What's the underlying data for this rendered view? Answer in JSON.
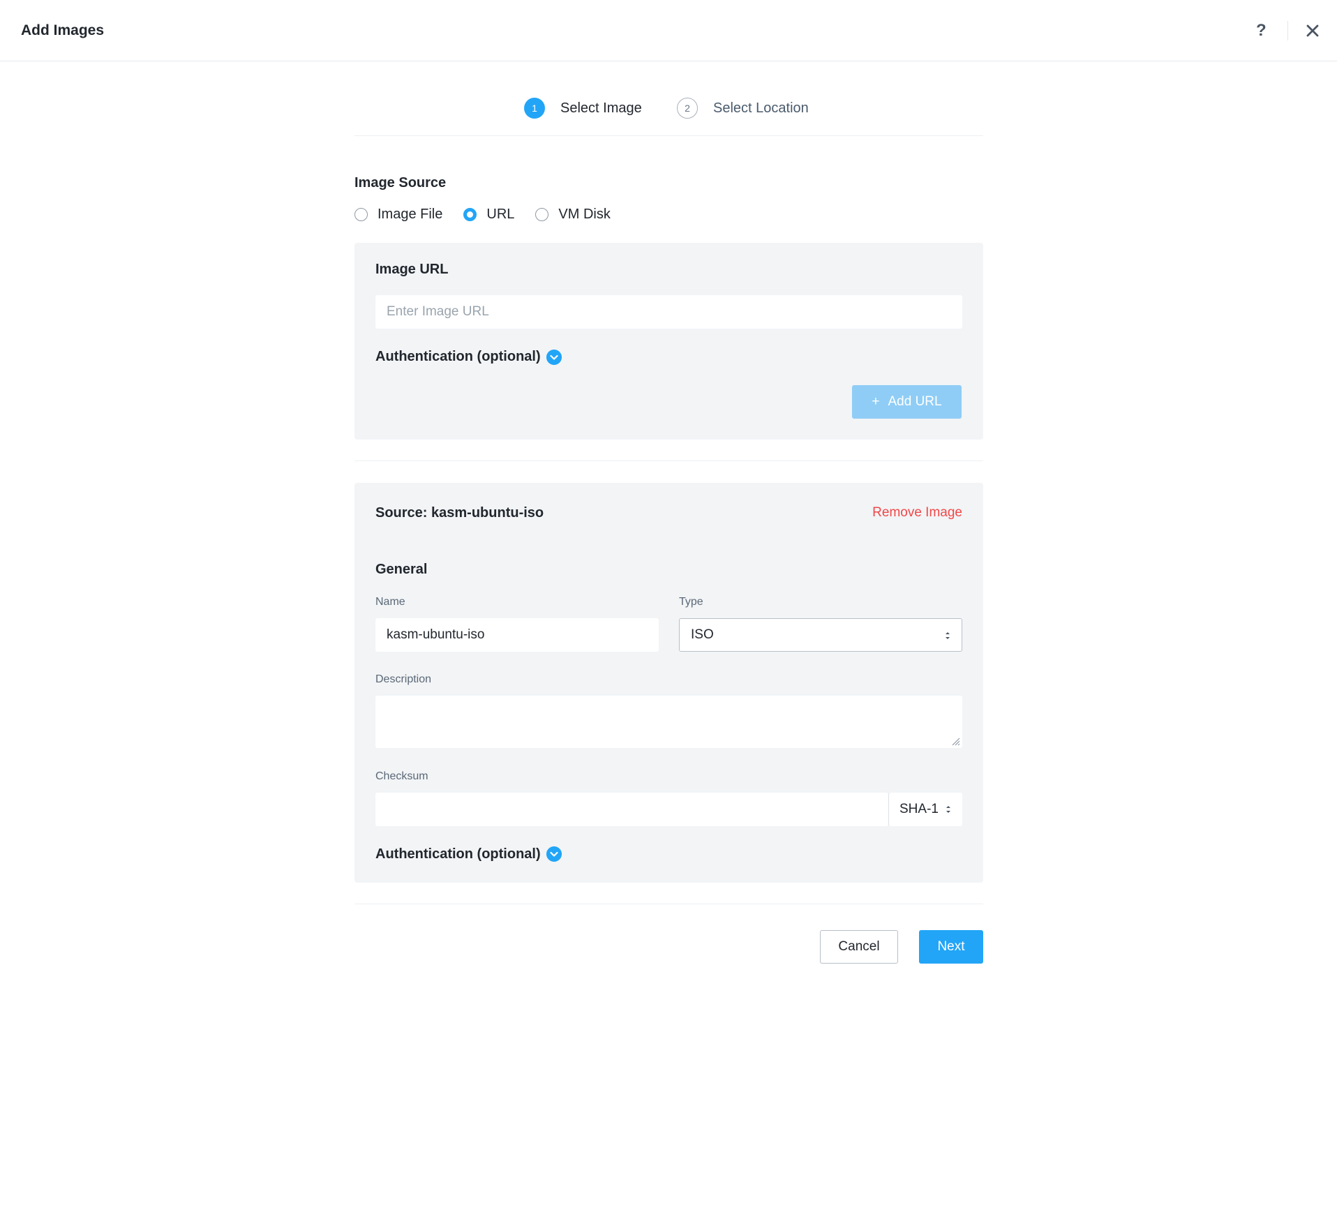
{
  "header": {
    "title": "Add Images",
    "help_icon": "?",
    "close_icon": "close-icon"
  },
  "steps": [
    {
      "num": "1",
      "label": "Select Image"
    },
    {
      "num": "2",
      "label": "Select Location"
    }
  ],
  "image_source": {
    "label": "Image Source",
    "options": [
      "Image File",
      "URL",
      "VM Disk"
    ],
    "selected": "URL"
  },
  "url_panel": {
    "label": "Image URL",
    "placeholder": "Enter Image URL",
    "auth_label": "Authentication (optional)",
    "add_url_label": "Add URL",
    "add_icon": "+"
  },
  "image_panel": {
    "source_title": "Source: kasm-ubuntu-iso",
    "remove_label": "Remove Image",
    "general_label": "General",
    "name_label": "Name",
    "name_value": "kasm-ubuntu-iso",
    "type_label": "Type",
    "type_value": "ISO",
    "description_label": "Description",
    "checksum_label": "Checksum",
    "checksum_algo": "SHA-1",
    "auth_label": "Authentication (optional)"
  },
  "footer": {
    "cancel_label": "Cancel",
    "next_label": "Next"
  },
  "colors": {
    "accent": "#22a5f7",
    "danger": "#f04848",
    "panel_bg": "#f2f4f6"
  }
}
